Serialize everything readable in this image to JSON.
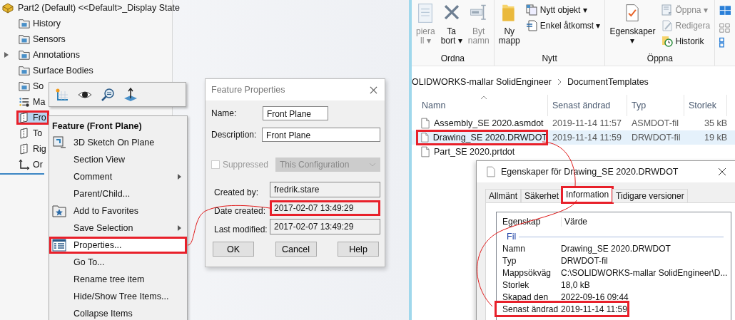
{
  "part_tree": {
    "root": "Part2 (Default) <<Default>_Display State",
    "items": [
      {
        "label": "History",
        "kind": "folder",
        "has_children": false,
        "selected": false,
        "highlighted": false
      },
      {
        "label": "Sensors",
        "kind": "folder",
        "has_children": false,
        "selected": false,
        "highlighted": false
      },
      {
        "label": "Annotations",
        "kind": "folder",
        "has_children": true,
        "selected": false,
        "highlighted": false
      },
      {
        "label": "Surface Bodies",
        "kind": "folder",
        "has_children": false,
        "selected": false,
        "highlighted": false
      },
      {
        "label": "So",
        "kind": "folder",
        "has_children": false,
        "selected": false,
        "highlighted": false
      },
      {
        "label": "Ma",
        "kind": "material",
        "has_children": false,
        "selected": false,
        "highlighted": false
      },
      {
        "label": "Fro",
        "kind": "plane",
        "has_children": false,
        "selected": true,
        "highlighted": true
      },
      {
        "label": "To",
        "kind": "plane",
        "has_children": false,
        "selected": false,
        "highlighted": false
      },
      {
        "label": "Rig",
        "kind": "plane",
        "has_children": false,
        "selected": false,
        "highlighted": false
      },
      {
        "label": "Or",
        "kind": "origin",
        "has_children": false,
        "selected": false,
        "highlighted": false
      }
    ]
  },
  "context_menu": {
    "title": "Feature (Front Plane)",
    "items": [
      {
        "label": "3D Sketch On Plane",
        "kind": "sketch",
        "submenu": false,
        "highlighted": false
      },
      {
        "label": "Section View",
        "kind": "text",
        "submenu": false,
        "highlighted": false
      },
      {
        "label": "Comment",
        "kind": "text",
        "submenu": true,
        "highlighted": false
      },
      {
        "label": "Parent/Child...",
        "kind": "text",
        "submenu": false,
        "highlighted": false
      },
      {
        "label": "Add to Favorites",
        "kind": "favorite",
        "submenu": false,
        "highlighted": false
      },
      {
        "label": "Save Selection",
        "kind": "text",
        "submenu": true,
        "highlighted": false
      },
      {
        "label": "Properties...",
        "kind": "properties",
        "submenu": false,
        "highlighted": true
      },
      {
        "label": "Go To...",
        "kind": "text",
        "submenu": false,
        "highlighted": false
      },
      {
        "label": "Rename tree item",
        "kind": "text",
        "submenu": false,
        "highlighted": false
      },
      {
        "label": "Hide/Show Tree Items...",
        "kind": "text",
        "submenu": false,
        "highlighted": false
      },
      {
        "label": "Collapse Items",
        "kind": "text",
        "submenu": false,
        "highlighted": false
      }
    ]
  },
  "feature_properties": {
    "title": "Feature Properties",
    "fields": [
      {
        "label": "Name:",
        "value": "Front Plane",
        "wide": false
      },
      {
        "label": "Description:",
        "value": "Front Plane",
        "wide": true
      }
    ],
    "suppressed": {
      "label": "Suppressed",
      "checked": false,
      "disabled": true
    },
    "configuration": {
      "value": "This Configuration",
      "disabled": true
    },
    "info": [
      {
        "label": "Created by:",
        "value": "fredrik.stare",
        "highlighted": false
      },
      {
        "label": "Date created:",
        "value": "2017-02-07 13:49:29",
        "highlighted": true
      },
      {
        "label": "Last modified:",
        "value": "2017-02-07 13:49:29",
        "highlighted": false
      }
    ],
    "buttons": [
      "OK",
      "Cancel",
      "Help"
    ]
  },
  "explorer": {
    "ribbon": [
      {
        "label": "Ordna",
        "large": [
          {
            "lines": [
              "piera",
              "ll ▾"
            ],
            "kind": "copy",
            "disabled": true
          },
          {
            "lines": [
              "Ta",
              "bort ▾"
            ],
            "kind": "delete",
            "disabled": false
          },
          {
            "lines": [
              "Byt",
              "namn"
            ],
            "kind": "rename",
            "disabled": true
          }
        ]
      },
      {
        "label": "Nytt",
        "large": [
          {
            "lines": [
              "Ny",
              "mapp"
            ],
            "kind": "folder",
            "disabled": false
          }
        ],
        "small": [
          {
            "label": "Nytt objekt ▾",
            "kind": "new-item",
            "disabled": false
          },
          {
            "label": "Enkel åtkomst ▾",
            "kind": "easy-access",
            "disabled": false
          }
        ]
      },
      {
        "label": "Öppna",
        "large": [
          {
            "lines": [
              "Egenskaper",
              "▾"
            ],
            "kind": "properties",
            "disabled": false
          }
        ],
        "small": [
          {
            "label": "Öppna ▾",
            "kind": "open",
            "disabled": true
          },
          {
            "label": "Redigera",
            "kind": "edit",
            "disabled": true
          },
          {
            "label": "Historik",
            "kind": "history",
            "disabled": false
          }
        ]
      }
    ],
    "breadcrumb": [
      "OLIDWORKS-mallar SolidEngineer",
      "DocumentTemplates"
    ],
    "columns": [
      "Namn",
      "Senast ändrad",
      "Typ",
      "Storlek"
    ],
    "files": [
      {
        "cells": [
          "Assembly_SE 2020.asmdot",
          "2019-11-14 11:57",
          "ASMDOT-fil",
          "35 kB"
        ],
        "selected": false,
        "highlighted": false
      },
      {
        "cells": [
          "Drawing_SE 2020.DRWDOT",
          "2019-11-14 11:59",
          "DRWDOT-fil",
          "19 kB"
        ],
        "selected": true,
        "highlighted": true
      },
      {
        "cells": [
          "Part_SE 2020.prtdot"
        ],
        "selected": false,
        "highlighted": false
      }
    ]
  },
  "file_properties": {
    "title": "Egenskaper för Drawing_SE 2020.DRWDOT",
    "tabs": [
      {
        "label": "Allmänt",
        "selected": false,
        "highlighted": false
      },
      {
        "label": "Säkerhet",
        "selected": false,
        "highlighted": false
      },
      {
        "label": "Information",
        "selected": true,
        "highlighted": true
      },
      {
        "label": "Tidigare versioner",
        "selected": false,
        "highlighted": false
      }
    ],
    "columns": [
      "Egenskap",
      "Värde"
    ],
    "group": "Fil",
    "rows": [
      {
        "label": "Namn",
        "value": "Drawing_SE 2020.DRWDOT",
        "highlighted": false
      },
      {
        "label": "Typ",
        "value": "DRWDOT-fil",
        "highlighted": false
      },
      {
        "label": "Mappsökväg",
        "value": "C:\\SOLIDWORKS-mallar SolidEngineer\\D...",
        "highlighted": false
      },
      {
        "label": "Storlek",
        "value": "18,0 kB",
        "highlighted": false
      },
      {
        "label": "Skapad den",
        "value": "2022-09-16 09:44",
        "highlighted": false
      },
      {
        "label": "Senast ändrad",
        "value": "2019-11-14 11:59",
        "highlighted": true
      }
    ]
  }
}
